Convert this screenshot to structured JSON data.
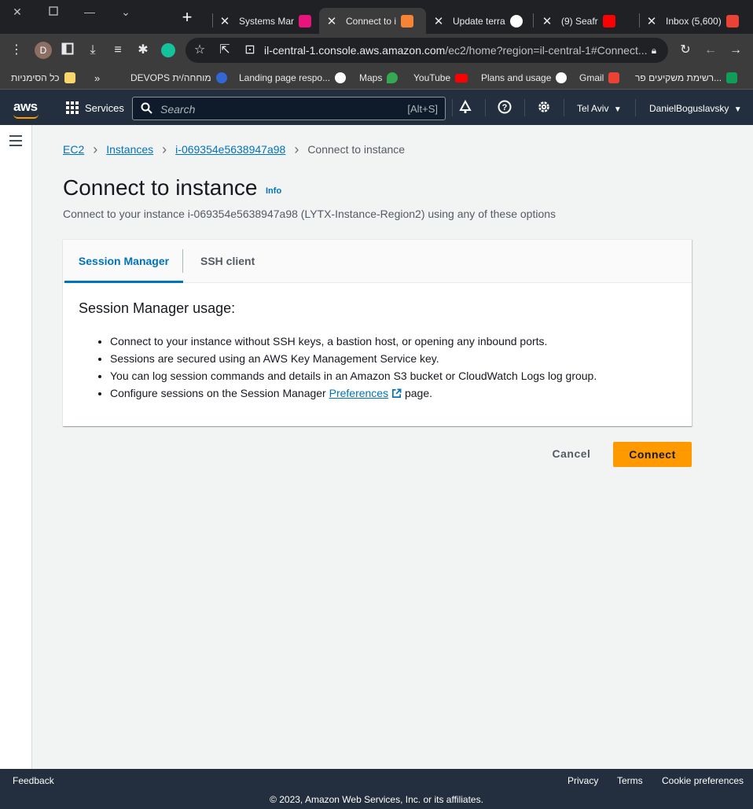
{
  "browser": {
    "tabs": [
      {
        "title": "Systems Mar",
        "fav": "#e7157b"
      },
      {
        "title": "Connect to i",
        "fav": "#f58534"
      },
      {
        "title": "Update terra",
        "fav": "#ffffff"
      },
      {
        "title": "(9) Seafr",
        "fav": "#ff0000"
      },
      {
        "title": "Inbox (5,600)",
        "fav": "#ea4335"
      }
    ],
    "url_host": "il-central-1.console.aws.amazon.com",
    "url_path": "/ec2/home?region=il-central-1#Connect...",
    "avatar_letter": "D",
    "bookmarks": {
      "all": "כל הסימניות",
      "devops": "DEVOPS מוחחה/ית",
      "landing": "Landing page respo...",
      "maps": "Maps",
      "youtube": "YouTube",
      "plans": "Plans and usage",
      "gmail": "Gmail",
      "hebrew": "רשימת משקיעים פר..."
    }
  },
  "aws": {
    "logo": "aws",
    "services": "Services",
    "search_placeholder": "Search",
    "search_shortcut": "[Alt+S]",
    "region": "Tel Aviv",
    "user": "DanielBoguslavsky"
  },
  "breadcrumb": {
    "ec2": "EC2",
    "instances": "Instances",
    "instance_id": "i-069354e5638947a98",
    "current": "Connect to instance"
  },
  "page": {
    "title": "Connect to instance",
    "info": "Info",
    "subtitle": "Connect to your instance i-069354e5638947a98 (LYTX-Instance-Region2) using any of these options"
  },
  "tabs": {
    "session_manager": "Session Manager",
    "ssh_client": "SSH client"
  },
  "usage": {
    "heading": "Session Manager usage:",
    "b1": "Connect to your instance without SSH keys, a bastion host, or opening any inbound ports.",
    "b2": "Sessions are secured using an AWS Key Management Service key.",
    "b3": "You can log session commands and details in an Amazon S3 bucket or CloudWatch Logs log group.",
    "b4_pre": "Configure sessions on the Session Manager ",
    "b4_link": "Preferences",
    "b4_post": " page."
  },
  "actions": {
    "cancel": "Cancel",
    "connect": "Connect"
  },
  "footer": {
    "feedback": "Feedback",
    "privacy": "Privacy",
    "terms": "Terms",
    "cookies": "Cookie preferences",
    "copyright": "© 2023, Amazon Web Services, Inc. or its affiliates."
  },
  "colors": {
    "accent": "#0073bb",
    "primary_button": "#ff9900",
    "nav_bg": "#232f3e"
  }
}
